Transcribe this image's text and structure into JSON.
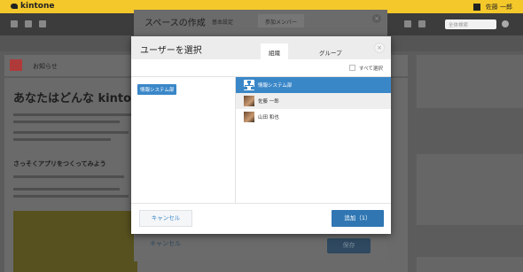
{
  "app": {
    "brand": "kintone",
    "user_name": "佐藤 一郎",
    "search_placeholder": "全体検索",
    "notice_title": "お知らせ",
    "page_heading": "あなたはどんな kintone",
    "section_heading": "さっそくアプリをつくってみよう"
  },
  "space_dialog": {
    "title": "スペースの作成",
    "tabs": [
      "基本設定",
      "参加メンバー"
    ],
    "active_tab": 1,
    "cancel_label": "キャンセル",
    "save_label": "保存"
  },
  "user_dialog": {
    "title": "ユーザーを選択",
    "tabs": [
      {
        "label": "組織",
        "active": true
      },
      {
        "label": "グループ",
        "active": false
      }
    ],
    "close_label": "×",
    "select_all_label": "すべて選択",
    "select_all_checked": false,
    "org_tree": [
      {
        "label": "情報システム部",
        "selected": true
      }
    ],
    "members": [
      {
        "label": "情報システム部",
        "type": "organization",
        "icon": "org-chart-icon",
        "selected": true
      },
      {
        "label": "佐藤 一郎",
        "type": "user",
        "icon": "user-photo",
        "selected": false
      },
      {
        "label": "山田 和也",
        "type": "user",
        "icon": "user-photo",
        "selected": false
      }
    ],
    "cancel_label": "キャンセル",
    "add_label": "追加（1）"
  },
  "colors": {
    "accent": "#3a87c8",
    "primary_button": "#2f76b3",
    "brand_bar": "#f4c82b"
  }
}
